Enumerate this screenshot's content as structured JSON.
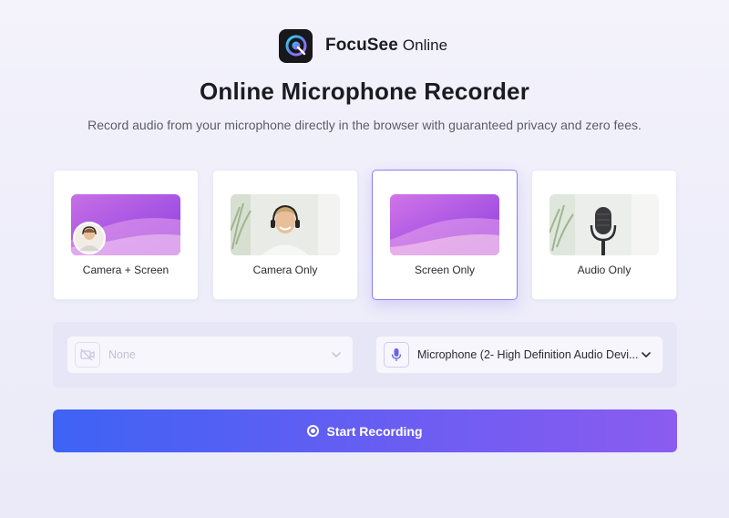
{
  "brand": {
    "name": "FocuSee",
    "sub": "Online",
    "logo_icon": "focusee-logo-icon"
  },
  "hero": {
    "title": "Online Microphone Recorder",
    "subtitle": "Record audio from your microphone directly in the browser with guaranteed privacy and zero fees."
  },
  "modes": [
    {
      "label": "Camera + Screen",
      "selected": false
    },
    {
      "label": "Camera Only",
      "selected": false
    },
    {
      "label": "Screen Only",
      "selected": true
    },
    {
      "label": "Audio Only",
      "selected": false
    }
  ],
  "selectors": {
    "camera": {
      "value": "None",
      "disabled": true,
      "icon": "camera-off-icon"
    },
    "microphone": {
      "value": "Microphone (2- High Definition Audio Devi...",
      "icon": "microphone-icon"
    }
  },
  "actions": {
    "start_label": "Start Recording"
  },
  "colors": {
    "accent": "#8e7ff0",
    "button_start": "#3d63f5",
    "button_end": "#8b5cf0"
  }
}
